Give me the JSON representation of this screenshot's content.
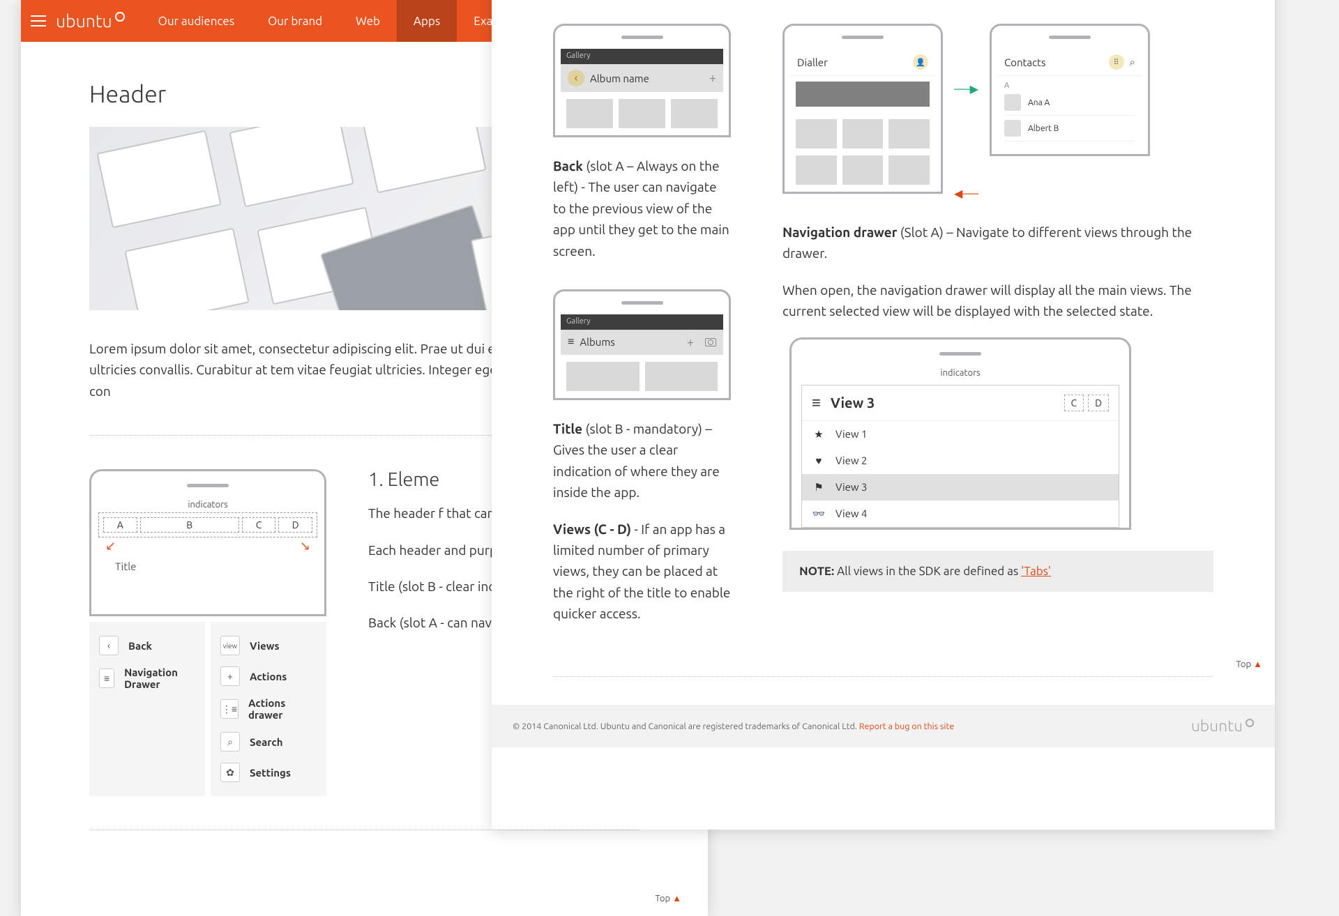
{
  "nav": {
    "brand": "ubuntu",
    "items": [
      "Our audiences",
      "Our brand",
      "Web",
      "Apps",
      "Exam"
    ],
    "active_index": 3
  },
  "page1": {
    "h1": "Header",
    "lorem": "Lorem ipsum dolor sit amet, consectetur adipiscing elit. Prae ut dui erat. Mauris mattis ultricies convallis. Curabitur at tem vitae feugiat ultricies. Integer egestas arcu pharetra nibh con",
    "slots": {
      "A": "A",
      "B": "B",
      "C": "C",
      "D": "D",
      "indicators": "indicators",
      "title_label": "Title"
    },
    "legend_left": [
      {
        "icon": "‹",
        "label": "Back"
      },
      {
        "icon": "≡",
        "label": "Navigation Drawer"
      }
    ],
    "legend_right": [
      {
        "icon_text": "view",
        "label": "Views"
      },
      {
        "icon": "+",
        "label": "Actions"
      },
      {
        "icon": "⋮≡",
        "label": "Actions drawer"
      },
      {
        "icon": "⌕",
        "label": "Search"
      },
      {
        "icon": "✿",
        "label": "Settings"
      }
    ],
    "sec_title": "1. Eleme",
    "paras": [
      "The header f that can be a the users' ne",
      "Each header and purpose",
      "Title (slot B - clear indicati app.",
      "Back (slot A - can navigate until they ge"
    ],
    "top_link": "Top"
  },
  "page2": {
    "top_link": "Top",
    "back_block": {
      "app_title": "Gallery",
      "header_label": "Album name",
      "desc_strong": "Back",
      "desc": " (slot A – Always on the left) - The user can navigate to the previous view of the app until they get to the main screen."
    },
    "title_block": {
      "app_title": "Gallery",
      "header_label": "Albums",
      "desc_strong": "Title",
      "desc": " (slot B - mandatory) –  Gives the user a clear indication of where they are inside the app.",
      "views_strong": "Views (C - D)",
      "views_desc": " - If an app has a limited number of primary views, they can be placed at the right of the title to enable quicker access."
    },
    "navdrawer": {
      "dialler_label": "Dialler",
      "contacts_label": "Contacts",
      "letter": "A",
      "contacts": [
        "Ana A",
        "Albert B"
      ],
      "desc_strong": "Navigation drawer",
      "desc_rest": " (Slot A) –  Navigate to different views through the drawer.",
      "desc2": "When open, the navigation drawer will display all the main views. The current selected view will be displayed with the selected state.",
      "indicators": "indicators",
      "current_view": "View 3",
      "slots": [
        "C",
        "D"
      ],
      "items": [
        {
          "icon": "★",
          "label": "View 1"
        },
        {
          "icon": "♥",
          "label": "View 2"
        },
        {
          "icon": "⚑",
          "label": "View 3",
          "sel": true
        },
        {
          "icon": "👓",
          "label": "View 4"
        }
      ]
    },
    "note": {
      "label": "NOTE:",
      "text": "  All views in the SDK are defined as ",
      "link": "'Tabs'"
    },
    "footer": {
      "copyright": "© 2014 Canonical Ltd. Ubuntu and Canonical are registered trademarks of Canonical Ltd. ",
      "bug_link": "Report a bug on this site",
      "logo": "ubuntu"
    }
  }
}
